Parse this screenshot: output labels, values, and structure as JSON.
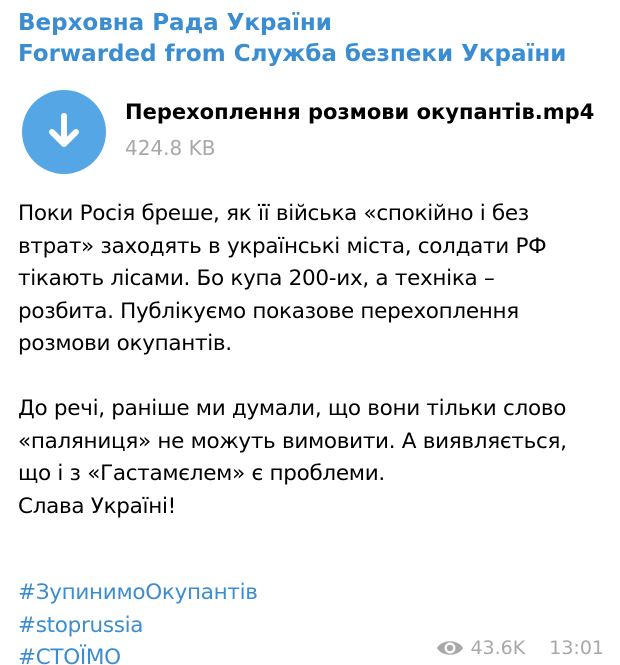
{
  "message": {
    "channel_name": "Верховна Рада України",
    "forwarded_from": "Forwarded from Служба безпеки України",
    "file": {
      "name": "Перехоплення розмови окупантів.mp4",
      "size": "424.8 KB",
      "icon": "download-arrow-icon"
    },
    "body_lines": [
      "Поки Росія бреше, як її війська «спокійно і без",
      "втрат» заходять в українські міста, солдати РФ",
      "тікають лісами. Бо купа 200-их, а техніка –",
      "розбита. Публікуємо показове перехоплення",
      "розмови окупантів.",
      "До речі, раніше ми думали, що вони тільки слово",
      "«паляниця» не можуть вимовити. А виявляється,",
      "що і з «Гастамєлем» є проблеми.",
      "Слава Україні!"
    ],
    "flag_emoji": "ukraine-flag-icon",
    "hashtags": [
      "#ЗупинимоОкупантів",
      "#stoprussia",
      "#СТОЇМО"
    ],
    "views": "43.6K",
    "time": "13:01"
  },
  "colors": {
    "link": "#3a8dd0",
    "download_button": "#55a6e4",
    "muted": "#a8a8a8",
    "flag_blue": "#2f74d0",
    "flag_yellow": "#f6d23c"
  }
}
